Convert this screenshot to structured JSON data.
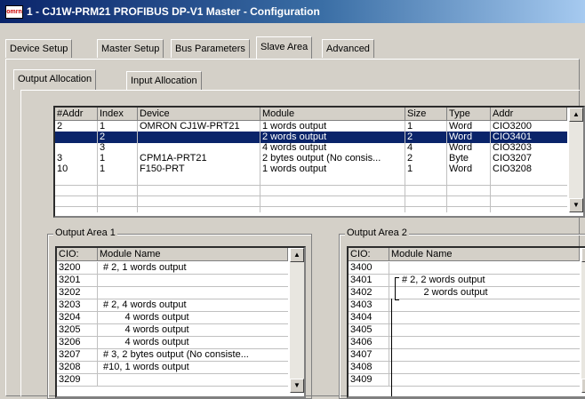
{
  "window": {
    "icon_text": "omrn",
    "title": "1 - CJ1W-PRM21 PROFIBUS DP-V1 Master - Configuration"
  },
  "tabs": [
    "Device Setup",
    "Master Setup",
    "Bus Parameters",
    "Slave Area",
    "Advanced"
  ],
  "subtabs": [
    "Output Allocation",
    "Input Allocation"
  ],
  "slave_table": {
    "columns": [
      "#Addr",
      "Index",
      "Device",
      "Module",
      "Size",
      "Type",
      "Addr"
    ],
    "rows": [
      [
        "2",
        "1",
        "OMRON CJ1W-PRT21",
        "1 words output",
        "1",
        "Word",
        "CIO3200"
      ],
      [
        "",
        "2",
        "",
        "2 words output",
        "2",
        "Word",
        "CIO3401"
      ],
      [
        "",
        "3",
        "",
        "4 words output",
        "4",
        "Word",
        "CIO3203"
      ],
      [
        "3",
        "1",
        "CPM1A-PRT21",
        "2 bytes output (No consis...",
        "2",
        "Byte",
        "CIO3207"
      ],
      [
        "10",
        "1",
        "F150-PRT",
        "1 words output",
        "1",
        "Word",
        "CIO3208"
      ]
    ],
    "selected_row": 1
  },
  "area1": {
    "label": "Output Area 1",
    "columns": [
      "CIO:",
      "Module Name"
    ],
    "rows": [
      [
        "3200",
        "# 2, 1 words output"
      ],
      [
        "3201",
        ""
      ],
      [
        "3202",
        ""
      ],
      [
        "3203",
        "# 2, 4 words output"
      ],
      [
        "3204",
        "        4 words output"
      ],
      [
        "3205",
        "        4 words output"
      ],
      [
        "3206",
        "        4 words output"
      ],
      [
        "3207",
        "# 3, 2 bytes output (No consiste..."
      ],
      [
        "3208",
        "#10, 1 words output"
      ],
      [
        "3209",
        ""
      ]
    ]
  },
  "area2": {
    "label": "Output Area 2",
    "columns": [
      "CIO:",
      "Module Name"
    ],
    "rows": [
      [
        "3400",
        ""
      ],
      [
        "3401",
        "# 2, 2 words output"
      ],
      [
        "3402",
        "        2 words output"
      ],
      [
        "3403",
        ""
      ],
      [
        "3404",
        ""
      ],
      [
        "3405",
        ""
      ],
      [
        "3406",
        ""
      ],
      [
        "3407",
        ""
      ],
      [
        "3408",
        ""
      ],
      [
        "3409",
        ""
      ]
    ]
  },
  "colors": {
    "selection": "#0a246a",
    "title_start": "#0a246a",
    "title_end": "#a6caf0"
  }
}
